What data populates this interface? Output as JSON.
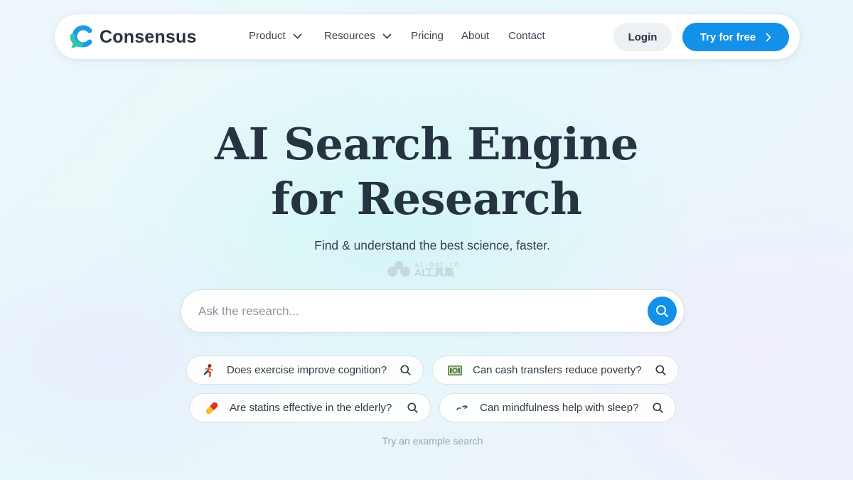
{
  "brand": {
    "name": "Consensus"
  },
  "nav": {
    "items": [
      {
        "label": "Product",
        "has_dropdown": true
      },
      {
        "label": "Resources",
        "has_dropdown": true
      },
      {
        "label": "Pricing",
        "has_dropdown": false
      },
      {
        "label": "About",
        "has_dropdown": false
      },
      {
        "label": "Contact",
        "has_dropdown": false
      }
    ],
    "login_label": "Login",
    "cta_label": "Try for free"
  },
  "hero": {
    "title_line1": "AI Search Engine",
    "title_line2": "for Research",
    "subtitle": "Find & understand the best science, faster."
  },
  "watermark": {
    "url": "ai-bot.cn",
    "name": "AI工具集"
  },
  "search": {
    "placeholder": "Ask the research..."
  },
  "examples": [
    {
      "label": "Does exercise improve cognition?",
      "icon": "running-person-icon"
    },
    {
      "label": "Can cash transfers reduce poverty?",
      "icon": "banknote-icon"
    },
    {
      "label": "Are statins effective in the elderly?",
      "icon": "pill-icon"
    },
    {
      "label": "Can mindfulness help with sleep?",
      "icon": "sleep-icon"
    }
  ],
  "hint": "Try an example search",
  "colors": {
    "accent": "#1390e8",
    "text": "#263340",
    "logo_teal": "#2fc5a8"
  }
}
